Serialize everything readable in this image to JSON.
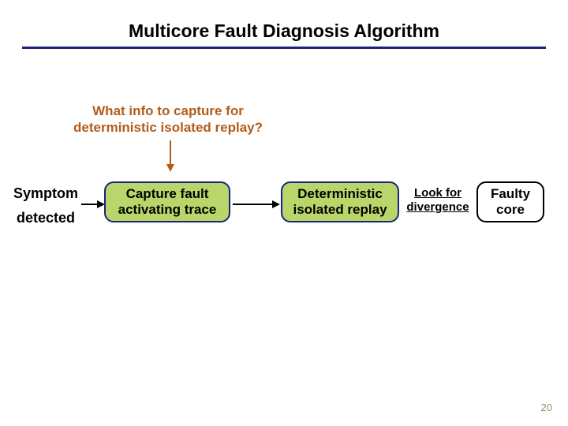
{
  "title": "Multicore Fault Diagnosis Algorithm",
  "question": "What info to capture for deterministic isolated replay?",
  "flow": {
    "symptom_line1": "Symptom",
    "symptom_line2": "detected",
    "capture": "Capture fault activating trace",
    "replay": "Deterministic isolated replay",
    "lookfor": "Look for divergence",
    "faulty": "Faulty core"
  },
  "slide_number": "20"
}
